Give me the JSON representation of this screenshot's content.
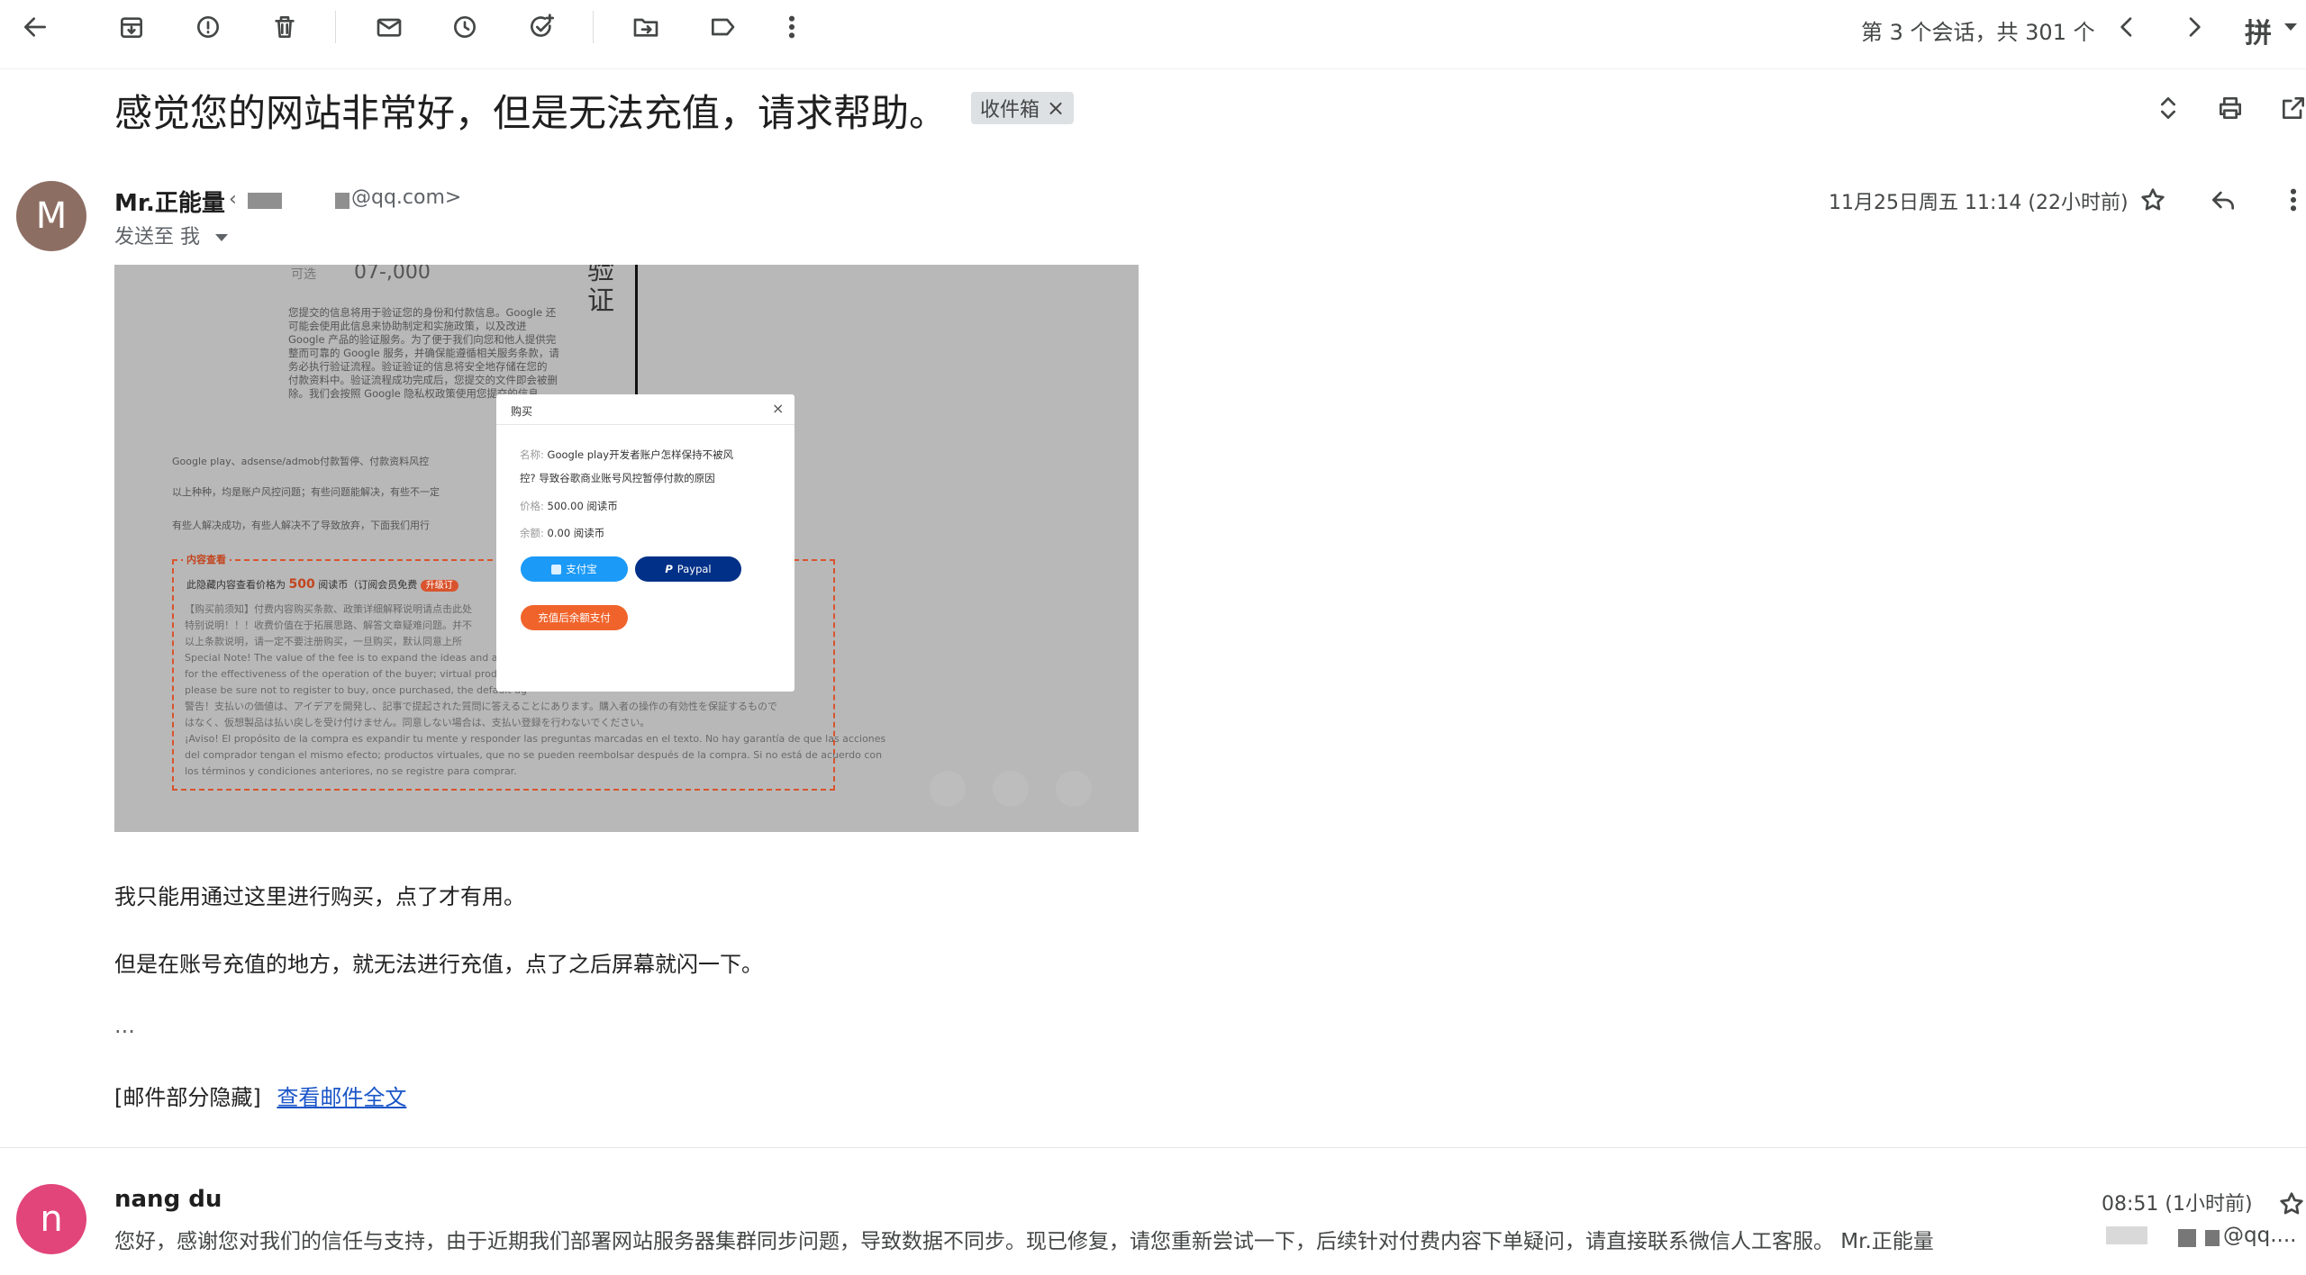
{
  "toolbar": {
    "pagination": "第 3 个会话，共 301 个",
    "input_method": "拼"
  },
  "thread": {
    "subject": "感觉您的网站非常好，但是无法充值，请求帮助。",
    "label": "收件箱",
    "label_remove": "×"
  },
  "message1": {
    "avatar_letter": "M",
    "avatar_color": "#8d6e63",
    "sender_name": "Mr.正能量",
    "sender_email_suffix": "@qq.com>",
    "recipient": "发送至 我",
    "date": "11月25日周五 11:14 (22小时前)",
    "screenshot": {
      "top_label": "可选",
      "top_value": "07-,000",
      "side_text": "验\n证",
      "privacy_lines": [
        "您提交的信息将用于验证您的身份和付款信息。Google 还",
        "可能会使用此信息来协助制定和实施政策，以及改进",
        "Google 产品的验证服务。为了便于我们向您和他人提供完",
        "整而可靠的 Google 服务，并确保能遵循相关服务条款，请",
        "务必执行验证流程。验证验证的信息将安全地存储在您的",
        "付款资料中。验证流程成功完成后，您提交的文件即会被删",
        "除。我们会按照 Google 隐私权政策使用您提交的信息。"
      ],
      "para1": "Google play、adsense/admob付款暂停、付款资料风控",
      "para2": "以上种种，均是账户风控问题；有些问题能解决，有些不一定",
      "para3": "有些人解决成功，有些人解决不了导致放弃，下面我们用行",
      "box_title": "内容查看",
      "box_price_prefix": "此隐藏内容查看价格为",
      "box_price": "500",
      "box_price_suffix": "阅读币（订阅会员免费",
      "box_badge": "升级订",
      "box_lines": [
        "【购买前须知】付费内容购买条款、政策详细解释说明请点击此处",
        "特别说明！！！收费价值在于拓展思路、解答文章疑难问题。并不",
        "以上条款说明，请一定不要注册购买，一旦购买，默认同意上所",
        "Special Note! The value of the fee is to expand the ideas and answer",
        "for the effectiveness of the operation of the buyer; virtual products,",
        "please be sure not to register to buy, once purchased, the default ag",
        "警告！支払いの価値は、アイデアを開発し、記事で提起された質問に答えることにあります。購入者の操作の有効性を保証するもので",
        "はなく、仮想製品は払い戻しを受け付けません。同意しない場合は、支払い登録を行わないでください。",
        "¡Aviso! El propósito de la compra es expandir tu mente y responder las preguntas marcadas en el texto. No hay garantía de que las acciones",
        "del comprador tengan el mismo efecto; productos virtuales, que no se pueden reembolsar después de la compra. Si no está de acuerdo con",
        "los términos y condiciones anteriores, no se registre para comprar."
      ],
      "modal": {
        "title": "购买",
        "close": "×",
        "name_label": "名称:",
        "name_value_1": "Google play开发者账户怎样保持不被风",
        "name_value_2": "控? 导致谷歌商业账号风控暂停付款的原因",
        "price_label": "价格:",
        "price_value": "500.00 阅读币",
        "balance_label": "余额:",
        "balance_value": "0.00 阅读币",
        "alipay_label": "支付宝",
        "paypal_label": "Paypal",
        "recharge_label": "充值后余额支付",
        "colors": {
          "alipay": "#1b9af7",
          "paypal": "#003087",
          "recharge": "#f0642c"
        }
      }
    },
    "body_line1": "我只能用通过这里进行购买，点了才有用。",
    "body_line2": "但是在账号充值的地方，就无法进行充值，点了之后屏幕就闪一下。",
    "ellipsis": "...",
    "clipped_prefix": "[邮件部分隐藏]",
    "clipped_link": "查看邮件全文"
  },
  "message2": {
    "avatar_letter": "n",
    "avatar_color": "#e1457a",
    "sender_name": "nang du",
    "date": "08:51 (1小时前)",
    "snippet": "您好，感谢您对我们的信任与支持，由于近期我们部署网站服务器集群同步问题，导致数据不同步。现已修复，请您重新尝试一下，后续针对付费内容下单疑问，请直接联系微信人工客服。 Mr.正能量",
    "snippet_tail": "@qq...."
  }
}
